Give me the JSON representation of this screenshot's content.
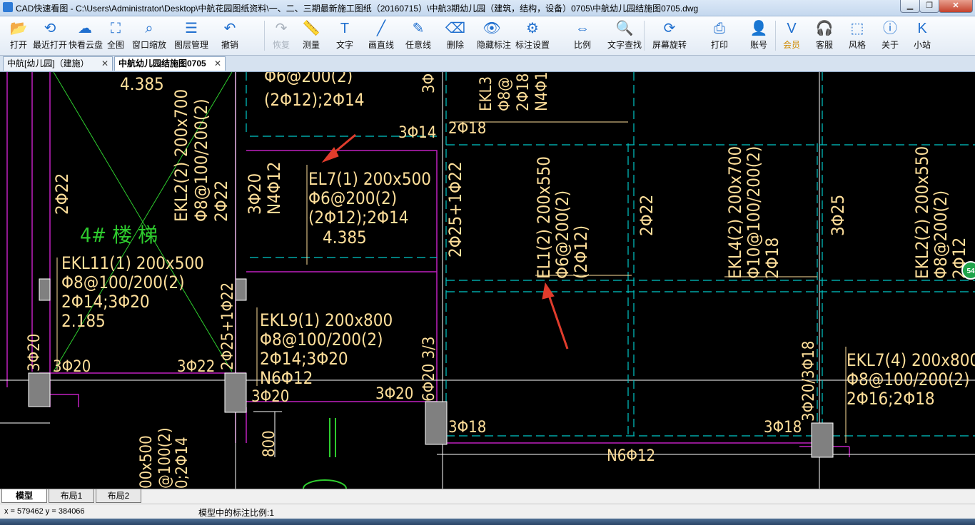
{
  "window": {
    "title": "CAD快速看图 - C:\\Users\\Administrator\\Desktop\\中航花园图纸资料\\一、二、三期最新施工图纸（20160715）\\中航3期幼儿园（建筑，结构，设备）0705\\中航幼儿园结施图0705.dwg",
    "minimize": "▁",
    "maximize": "❐",
    "close": "✕"
  },
  "toolbar": [
    {
      "label": "打开",
      "icon": "folder-open-icon",
      "glyph": "📂"
    },
    {
      "label": "最近打开",
      "icon": "recent-icon",
      "glyph": "⟲"
    },
    {
      "label": "快看云盘",
      "icon": "cloud-icon",
      "glyph": "☁"
    },
    {
      "label": "全图",
      "icon": "fit-all-icon",
      "glyph": "⛶"
    },
    {
      "label": "窗口缩放",
      "icon": "zoom-window-icon",
      "glyph": "⌕"
    },
    {
      "label": "图层管理",
      "icon": "layers-icon",
      "glyph": "☰"
    },
    {
      "label": "撤销",
      "icon": "undo-icon",
      "glyph": "↶"
    },
    {
      "label": "恢复",
      "icon": "redo-icon",
      "glyph": "↷"
    },
    {
      "label": "测量",
      "icon": "measure-icon",
      "glyph": "📏"
    },
    {
      "label": "文字",
      "icon": "text-icon",
      "glyph": "T"
    },
    {
      "label": "画直线",
      "icon": "line-icon",
      "glyph": "╱"
    },
    {
      "label": "任意线",
      "icon": "pen-icon",
      "glyph": "✎"
    },
    {
      "label": "删除",
      "icon": "eraser-icon",
      "glyph": "⌫"
    },
    {
      "label": "隐藏标注",
      "icon": "eye-hide-icon",
      "glyph": "👁"
    },
    {
      "label": "标注设置",
      "icon": "settings-icon",
      "glyph": "⚙"
    },
    {
      "label": "比例",
      "icon": "scale-icon",
      "glyph": "⇔"
    },
    {
      "label": "文字查找",
      "icon": "text-search-icon",
      "glyph": "🔍"
    },
    {
      "label": "屏幕旋转",
      "icon": "rotate-icon",
      "glyph": "⟳"
    },
    {
      "label": "打印",
      "icon": "print-icon",
      "glyph": "⎙"
    },
    {
      "label": "账号",
      "icon": "user-icon",
      "glyph": "👤"
    },
    {
      "label": "会员",
      "icon": "vip-icon",
      "glyph": "V"
    },
    {
      "label": "客服",
      "icon": "headset-icon",
      "glyph": "🎧"
    },
    {
      "label": "风格",
      "icon": "style-icon",
      "glyph": "⬚"
    },
    {
      "label": "关于",
      "icon": "info-icon",
      "glyph": "ⓘ"
    },
    {
      "label": "小站",
      "icon": "site-icon",
      "glyph": "K"
    }
  ],
  "doc_tabs": [
    {
      "label": "中航[幼儿园]（建施）",
      "close": "✕"
    },
    {
      "label": "中航幼儿园结施图0705",
      "close": "✕"
    }
  ],
  "drawing": {
    "labels": [
      "4.385",
      "Φ6@200(2)",
      "(2Φ12);2Φ14",
      "3Φ14",
      "2Φ18",
      "EKL2(2) 200x700",
      "Φ8@100/200(2)",
      "2Φ22",
      "EL7(1) 200x500",
      "Φ6@200(2)",
      "(2Φ12);2Φ14",
      "4.385",
      "3Φ20",
      "N4Φ12",
      "4# 楼 梯",
      "EKL11(1) 200x500",
      "Φ8@100/200(2)",
      "2Φ14;3Φ20",
      "2.185",
      "EKL9(1) 200x800",
      "Φ8@100/200(2)",
      "2Φ14;3Φ20",
      "N6Φ12",
      "3Φ20",
      "3Φ22",
      "3Φ20",
      "3Φ20",
      "3Φ18",
      "N6Φ12",
      "3Φ18",
      "EL1(2) 200x550",
      "Φ6@200(2)",
      "(2Φ12)",
      "EKL4(2) 200x700",
      "Φ10@100/200(2)",
      "2Φ18",
      "EKL2(2) 200x550",
      "Φ8@200(2)",
      "2Φ12",
      "2Φ25+1Φ22",
      "2Φ22",
      "3Φ25",
      "EKL7(4) 200x800",
      "Φ8@100/200(2)",
      "2Φ16;2Φ18",
      "3Φ20/3Φ18",
      "2Φ22",
      "3Φ20",
      "6Φ20 3/3",
      "2Φ25+1Φ22",
      "800",
      "EKL3",
      "Φ8@",
      "2Φ18",
      "N4Φ1",
      "00x500",
      "@100(2)",
      "0;2Φ14",
      "3Φ"
    ]
  },
  "layout_tabs": [
    "模型",
    "布局1",
    "布局2"
  ],
  "status": {
    "coords": "x = 579462  y = 384066",
    "scale": "模型中的标注比例:1"
  },
  "float_badge": "54",
  "colors": {
    "canvas_bg": "#000000",
    "beam_text": "#ffdf9a",
    "grid_line": "#00c8c8",
    "stair_text": "#2ecc2e",
    "outline": "#c020c0",
    "arrow": "#e03c2c"
  }
}
